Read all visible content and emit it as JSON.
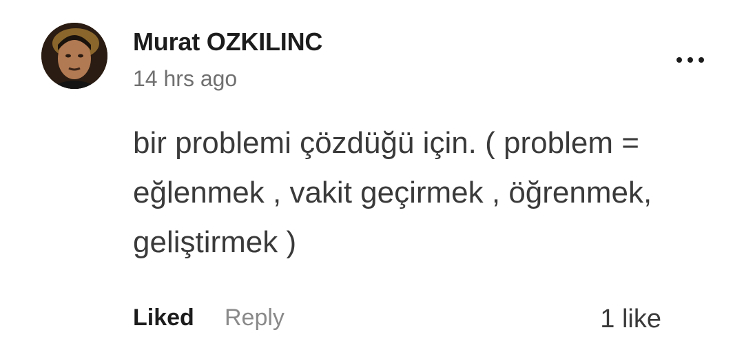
{
  "comment": {
    "author": "Murat OZKILINC",
    "timestamp": "14 hrs ago",
    "text": "bir problemi çözdüğü için. ( problem = eğlenmek , vakit geçirmek , öğrenmek, geliştirmek )",
    "avatar_icon": "user-avatar-photo",
    "more_icon": "more-options-icon"
  },
  "actions": {
    "liked_label": "Liked",
    "reply_label": "Reply",
    "like_count": "1 like"
  },
  "colors": {
    "author": "#1c1c1c",
    "timestamp": "#707070",
    "body": "#3a3a3a",
    "reply": "#8a8a8a",
    "background": "#ffffff"
  }
}
